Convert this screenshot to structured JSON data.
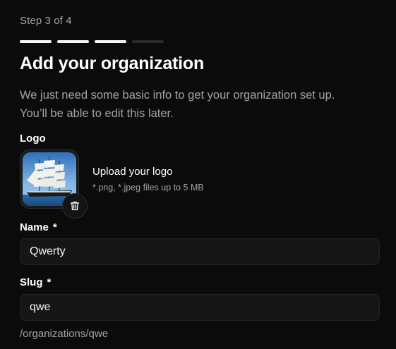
{
  "step": {
    "label": "Step 3 of 4",
    "current": 3,
    "total": 4
  },
  "header": {
    "title": "Add your organization",
    "subtitle_line1": "We just need some basic info to get your organization set up.",
    "subtitle_line2": "You’ll be able to edit this later."
  },
  "logo": {
    "label": "Logo",
    "upload_title": "Upload your logo",
    "upload_hint": "*.png, *.jpeg files up to 5 MB",
    "delete_icon": "trash-icon"
  },
  "fields": {
    "name": {
      "label": "Name",
      "required_marker": "*",
      "value": "Qwerty"
    },
    "slug": {
      "label": "Slug",
      "required_marker": "*",
      "value": "qwe",
      "preview": "/organizations/qwe"
    }
  },
  "colors": {
    "background": "#0b0b0b",
    "progress_done": "#f5f5f5",
    "progress_pending": "#2a2a2a",
    "muted_text": "#a3a3a3",
    "input_bg": "#161616"
  }
}
